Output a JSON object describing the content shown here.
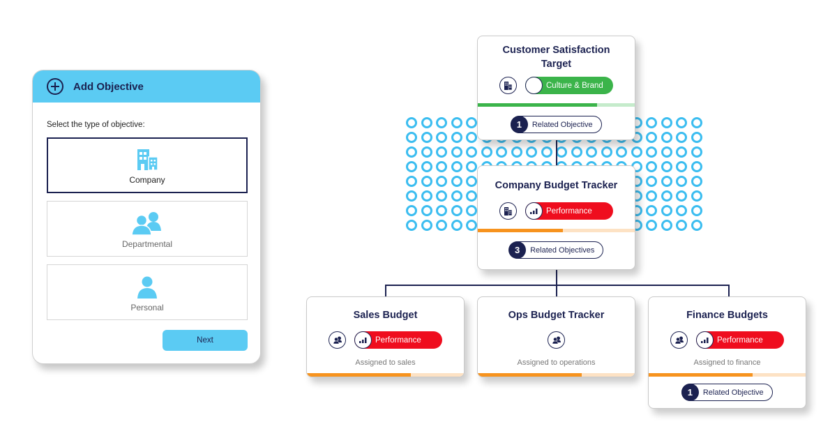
{
  "colors": {
    "navy": "#1b2150",
    "sky": "#5bcbf3",
    "dot": "#3bbdf0",
    "green": "#3bb44a",
    "green_light": "#c5ebcb",
    "red": "#ef0d1e",
    "orange": "#f7931e",
    "orange_light": "#fde2c4"
  },
  "add_objective": {
    "title": "Add Objective",
    "title_icon": "plus-circle-icon",
    "prompt": "Select the type of objective:",
    "options": [
      {
        "label": "Company",
        "icon": "building-icon",
        "selected": true
      },
      {
        "label": "Departmental",
        "icon": "group-icon",
        "selected": false
      },
      {
        "label": "Personal",
        "icon": "person-icon",
        "selected": false
      }
    ],
    "next_label": "Next"
  },
  "cards": {
    "customer": {
      "title": "Customer Satisfaction Target",
      "type_icon": "building-icon",
      "category": "Culture & Brand",
      "category_icon": "empty-knob",
      "progress": 0.76,
      "related_count": "1",
      "related_label": "Related Objective"
    },
    "company": {
      "title": "Company Budget Tracker",
      "type_icon": "building-icon",
      "category": "Performance",
      "category_icon": "bar-chart-icon",
      "progress": 0.54,
      "related_count": "3",
      "related_label": "Related Objectives"
    },
    "sales": {
      "title": "Sales Budget",
      "type_icon": "group-icon",
      "category": "Performance",
      "category_icon": "bar-chart-icon",
      "assigned": "Assigned to sales",
      "progress": 0.66
    },
    "ops": {
      "title": "Ops Budget Tracker",
      "type_icon": "group-icon",
      "assigned": "Assigned to operations",
      "progress": 0.66
    },
    "finance": {
      "title": "Finance Budgets",
      "type_icon": "group-icon",
      "category": "Performance",
      "category_icon": "bar-chart-icon",
      "assigned": "Assigned to finance",
      "progress": 0.66,
      "related_count": "1",
      "related_label": "Related Objective"
    }
  }
}
